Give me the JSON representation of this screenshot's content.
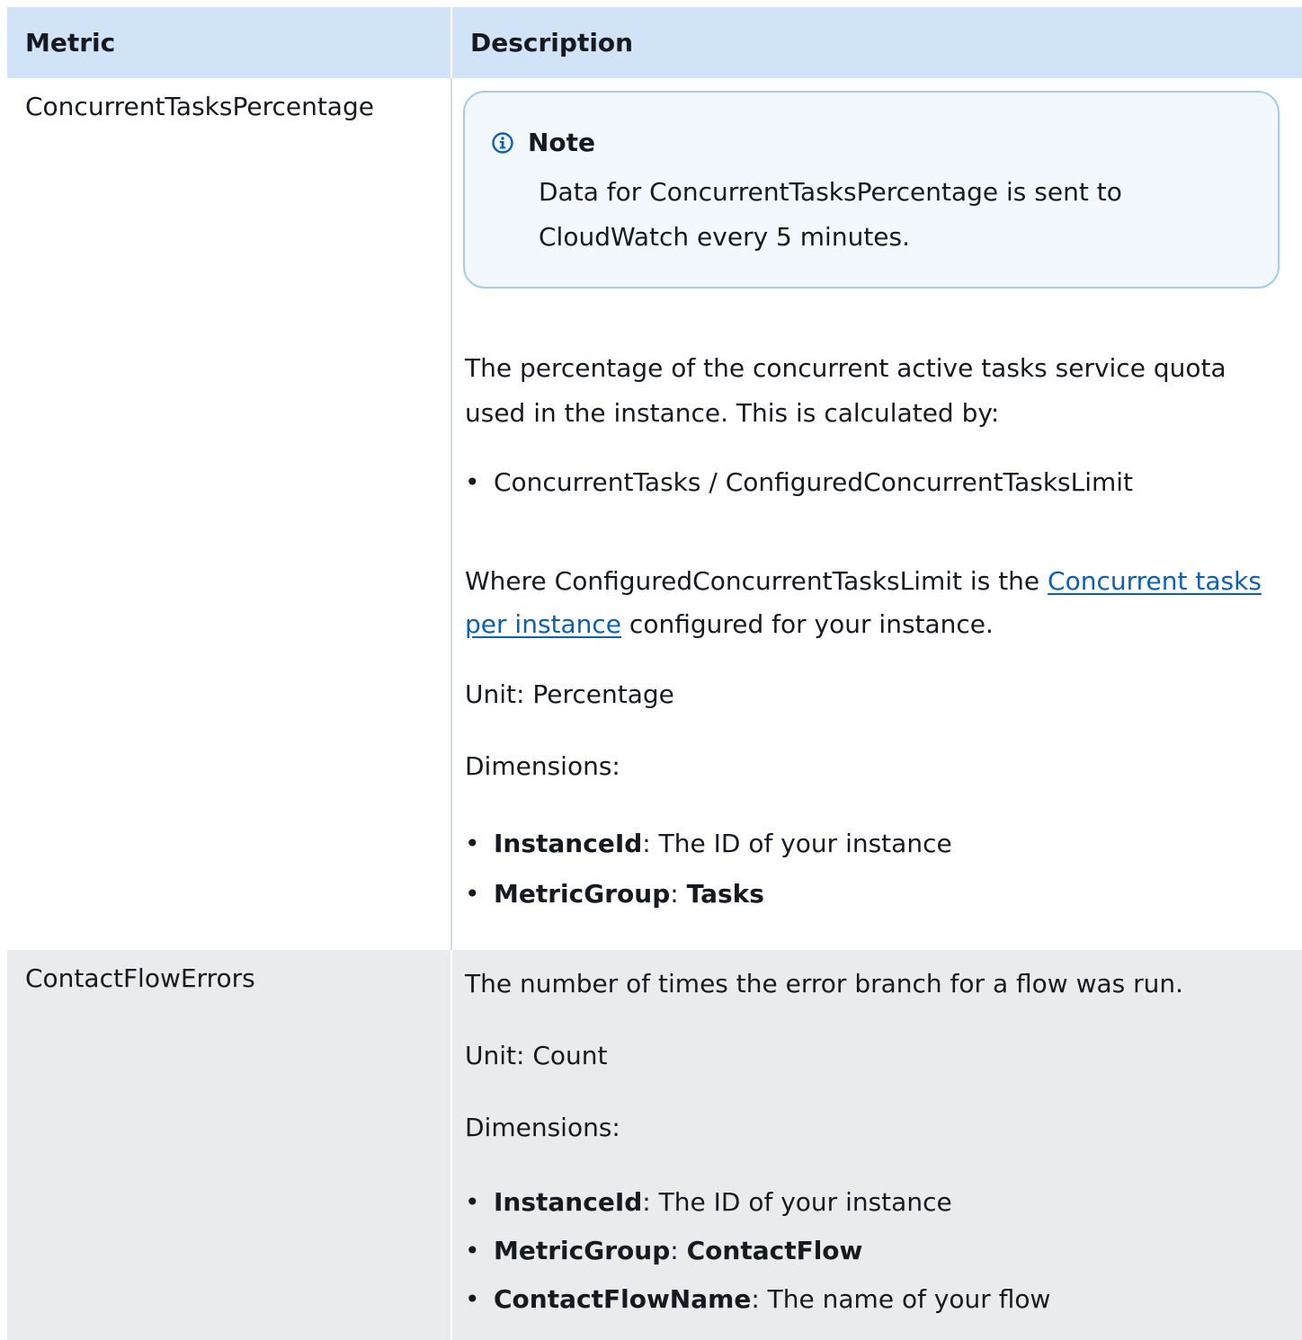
{
  "table": {
    "headers": [
      "Metric",
      "Description"
    ],
    "rows": [
      {
        "metric": "ConcurrentTasksPercentage",
        "note": {
          "title": "Note",
          "body": "Data for ConcurrentTasksPercentage is sent to CloudWatch every 5 minutes.",
          "icon": "info-icon"
        },
        "description": "The percentage of the concurrent active tasks service quota used in the instance. This is calculated by:",
        "formula": "ConcurrentTasks / ConfiguredConcurrentTasksLimit",
        "where_prefix": "Where ConfiguredConcurrentTasksLimit is the ",
        "where_link": "Concurrent tasks per instance",
        "where_suffix": " configured for your instance.",
        "unit": "Unit: Percentage",
        "dimensions_label": "Dimensions:",
        "dimensions": [
          {
            "key": "InstanceId",
            "sep": ": ",
            "value": "The ID of your instance",
            "value_bold": false
          },
          {
            "key": "MetricGroup",
            "sep": ": ",
            "value": "Tasks",
            "value_bold": true
          }
        ]
      },
      {
        "metric": "ContactFlowErrors",
        "description": "The number of times the error branch for a flow was run.",
        "unit": "Unit: Count",
        "dimensions_label": "Dimensions:",
        "dimensions": [
          {
            "key": "InstanceId",
            "sep": ": ",
            "value": "The ID of your instance",
            "value_bold": false
          },
          {
            "key": "MetricGroup",
            "sep": ": ",
            "value": "ContactFlow",
            "value_bold": true
          },
          {
            "key": "ContactFlowName",
            "sep": ": ",
            "value": "The name of your flow",
            "value_bold": false
          }
        ]
      }
    ]
  },
  "colors": {
    "header_bg": "#d1e4f7",
    "row_alt_bg": "#e9ebed",
    "note_border": "#a6cbef",
    "note_bg": "#f2f8fd",
    "link": "#0a60b5",
    "info_icon": "#0a60b5"
  }
}
